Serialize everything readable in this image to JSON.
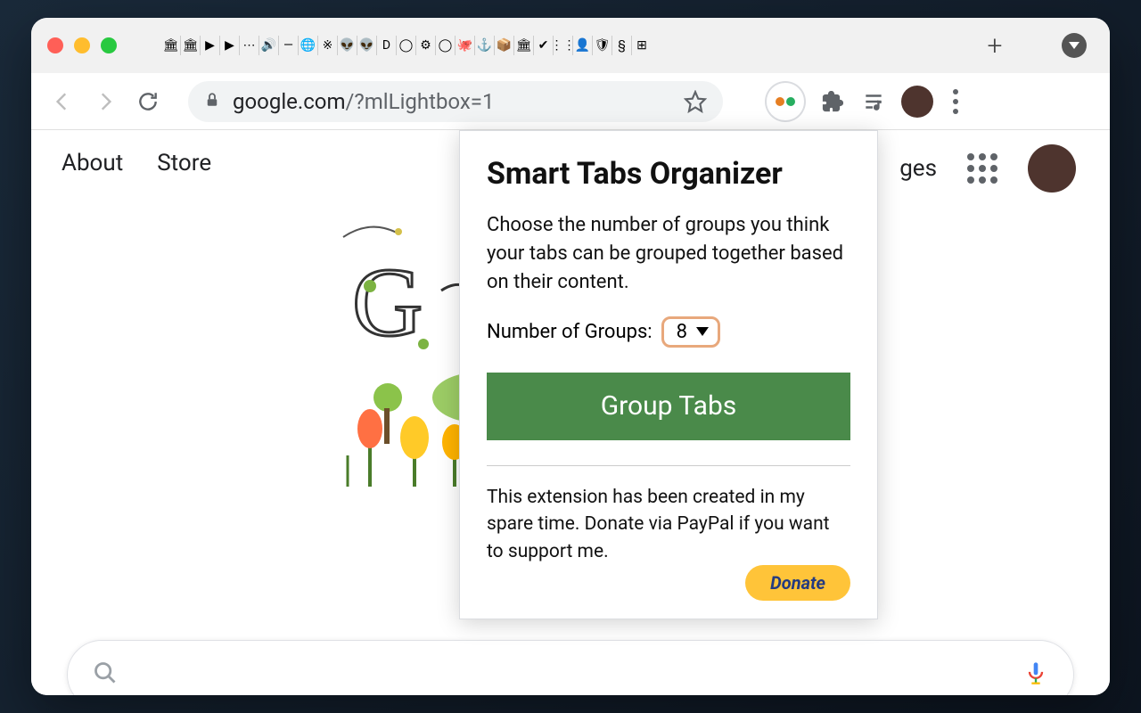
{
  "toolbar": {
    "url_display_host": "google.com",
    "url_display_path": "/?mlLightbox=1"
  },
  "google_nav": {
    "about": "About",
    "store": "Store",
    "images": "ges"
  },
  "extension_popup": {
    "title": "Smart Tabs Organizer",
    "description": "Choose the number of groups you think your tabs can be grouped together based on their content.",
    "groups_label": "Number of Groups:",
    "groups_value": "8",
    "action_label": "Group Tabs",
    "donate_text": "This extension has been created in my spare time. Donate via PayPal if you want to support me.",
    "donate_label": "Donate"
  },
  "tab_icons": [
    "🏛",
    "🏛",
    "▶",
    "▶",
    "⋯",
    "🔊",
    "—",
    "🌐",
    "※",
    "👽",
    "👽",
    "D",
    "◯",
    "⚙",
    "◯",
    "🐙",
    "⚓",
    "📦",
    "🏛",
    "✔",
    "⋮⋮",
    "👤",
    "🛡",
    "§",
    "⊞"
  ]
}
